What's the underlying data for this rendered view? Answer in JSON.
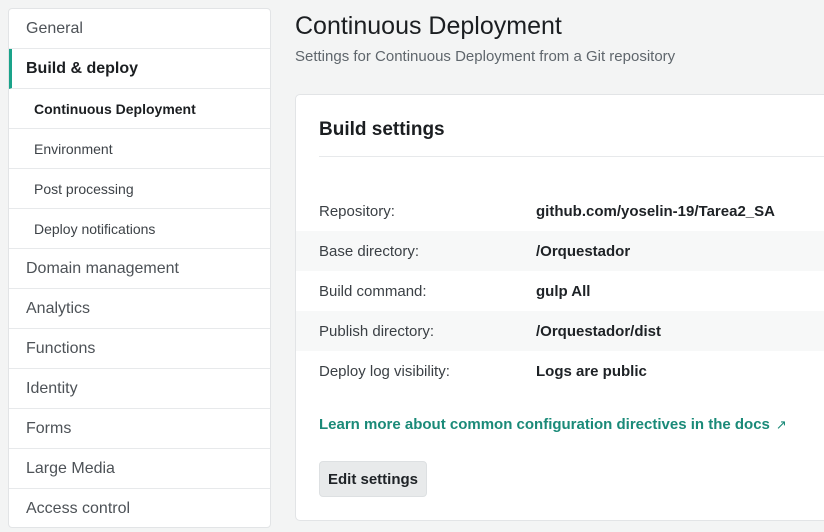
{
  "sidebar": {
    "items": [
      {
        "label": "General"
      },
      {
        "label": "Build & deploy"
      },
      {
        "label": "Continuous Deployment"
      },
      {
        "label": "Environment"
      },
      {
        "label": "Post processing"
      },
      {
        "label": "Deploy notifications"
      },
      {
        "label": "Domain management"
      },
      {
        "label": "Analytics"
      },
      {
        "label": "Functions"
      },
      {
        "label": "Identity"
      },
      {
        "label": "Forms"
      },
      {
        "label": "Large Media"
      },
      {
        "label": "Access control"
      }
    ]
  },
  "header": {
    "title": "Continuous Deployment",
    "subtitle": "Settings for Continuous Deployment from a Git repository"
  },
  "build_settings": {
    "title": "Build settings",
    "rows": [
      {
        "label": "Repository:",
        "value": "github.com/yoselin-19/Tarea2_SA"
      },
      {
        "label": "Base directory:",
        "value": "/Orquestador"
      },
      {
        "label": "Build command:",
        "value": "gulp All"
      },
      {
        "label": "Publish directory:",
        "value": "/Orquestador/dist"
      },
      {
        "label": "Deploy log visibility:",
        "value": "Logs are public"
      }
    ],
    "docs_link": "Learn more about common configuration directives in the docs",
    "docs_link_icon": "↗",
    "edit_button": "Edit settings"
  },
  "colors": {
    "accent": "#1aa38a",
    "link": "#1a8a78"
  }
}
